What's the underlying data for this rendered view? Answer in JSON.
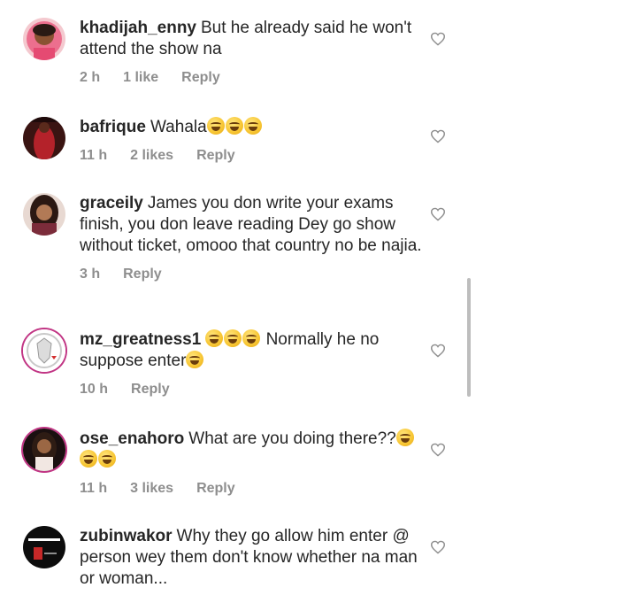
{
  "comments": [
    {
      "username": "khadijah_enny",
      "text": "But he already said he won't attend the show na",
      "time": "2 h",
      "likes": "1 like",
      "reply": "Reply",
      "emoji_count": 0
    },
    {
      "username": "bafrique",
      "text": "Wahala",
      "time": "11 h",
      "likes": "2 likes",
      "reply": "Reply",
      "emoji_count": 3
    },
    {
      "username": "graceily",
      "text": "James you don write your exams finish, you don leave reading Dey go show without ticket, omooo that country no be najia.",
      "time": "3 h",
      "likes": "",
      "reply": "Reply",
      "emoji_count": 0
    },
    {
      "username": "mz_greatness1",
      "text_before": "",
      "text": "Normally he no suppose enter",
      "time": "10 h",
      "likes": "",
      "reply": "Reply",
      "emoji_count": 4
    },
    {
      "username": "ose_enahoro",
      "text": "What are you doing there??",
      "time": "11 h",
      "likes": "3 likes",
      "reply": "Reply",
      "emoji_count": 3
    },
    {
      "username": "zubinwakor",
      "text": "Why they go allow him enter @ person wey them don't know whether na man or woman...",
      "time": "",
      "likes": "",
      "reply": "",
      "emoji_count": 0
    }
  ],
  "icons": {
    "like": "heart-outline-icon"
  },
  "colors": {
    "text": "#262626",
    "meta": "#8e8e8e",
    "avatar_ring": "#c13584"
  }
}
